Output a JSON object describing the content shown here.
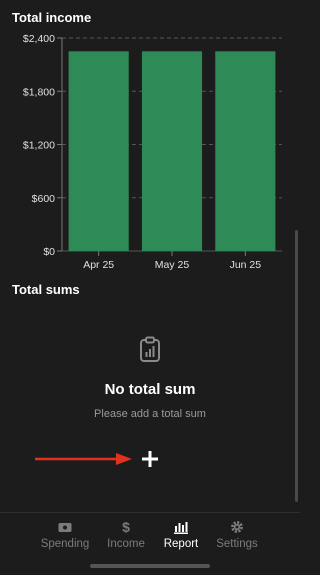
{
  "sections": {
    "income_title": "Total income",
    "sums_title": "Total sums"
  },
  "chart_data": {
    "type": "bar",
    "categories": [
      "Apr 25",
      "May 25",
      "Jun 25"
    ],
    "values": [
      2250,
      2250,
      2250
    ],
    "ylim": [
      0,
      2400
    ],
    "yticks": [
      0,
      600,
      1200,
      1800,
      2400
    ],
    "ytick_labels": [
      "$0",
      "$600",
      "$1,200",
      "$1,800",
      "$2,400"
    ],
    "grid": true,
    "bar_color": "#2e8b57"
  },
  "empty_state": {
    "icon": "clipboard-icon",
    "title": "No total sum",
    "subtitle": "Please add a total sum"
  },
  "add_button": {
    "label": "+",
    "arrow_color": "#e0321f"
  },
  "tabs": [
    {
      "label": "Spending",
      "icon": "wallet-icon",
      "active": false
    },
    {
      "label": "Income",
      "icon": "dollar-icon",
      "active": false
    },
    {
      "label": "Report",
      "icon": "bar-chart-icon",
      "active": true
    },
    {
      "label": "Settings",
      "icon": "gear-icon",
      "active": false
    }
  ]
}
